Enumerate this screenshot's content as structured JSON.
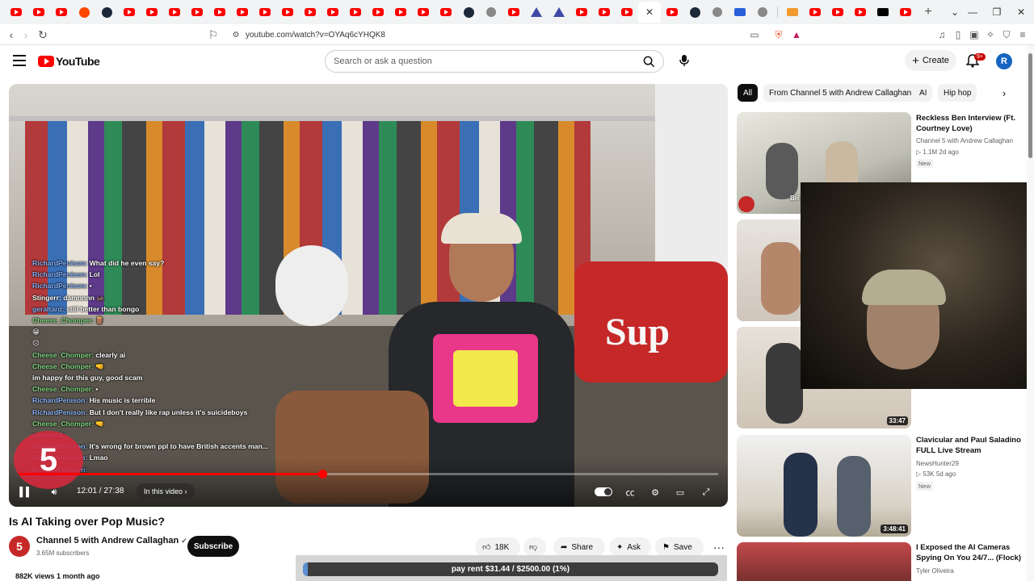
{
  "browser": {
    "url": "youtube.com/watch?v=OYAq6cYHQK8",
    "tab_icons": [
      "youtube",
      "youtube",
      "youtube",
      "reddit",
      "steam",
      "youtube",
      "youtube",
      "youtube",
      "youtube",
      "youtube",
      "youtube",
      "youtube",
      "youtube",
      "youtube",
      "youtube",
      "youtube",
      "youtube",
      "youtube",
      "youtube",
      "youtube",
      "steam",
      "gray",
      "youtube",
      "tri",
      "tri",
      "youtube",
      "youtube",
      "youtube",
      "active",
      "youtube",
      "steam",
      "gray",
      "blue",
      "gray"
    ],
    "tab_icons_right": [
      "orange",
      "youtube",
      "youtube",
      "youtube",
      "x",
      "youtube"
    ],
    "active_tab_close": "✕"
  },
  "youtube": {
    "logo_text": "YouTube",
    "search_placeholder": "Search or ask a question",
    "create_label": "Create",
    "notification_badge": "9+",
    "avatar_letter": "R"
  },
  "video": {
    "title": "Is AI Taking over Pop Music?",
    "channel": "Channel 5 with Andrew Callaghan",
    "subscribers": "3.65M subscribers",
    "subscribe_label": "Subscribe",
    "likes": "18K",
    "share_label": "Share",
    "ask_label": "Ask",
    "save_label": "Save",
    "views_date": "882K views  1 month ago",
    "time_current": "12:01",
    "time_total": "27:38",
    "progress_fraction": 0.434,
    "in_this_video": "In this video",
    "pillow_text": "Sup",
    "logo_mark": "5"
  },
  "chat": [
    {
      "user": "RichardPenison",
      "msg": "What did he even say?",
      "color": "blue"
    },
    {
      "user": "RichardPenison",
      "msg": "Lol",
      "color": "blue"
    },
    {
      "user": "RichardPenison",
      "msg": "▪",
      "color": "blue"
    },
    {
      "user": "Stingerr",
      "msg": "damnnnn 🦗",
      "color": "white"
    },
    {
      "user": "geraltard",
      "msg": "still better than bongo",
      "color": "blue"
    },
    {
      "user": "",
      "msg": "",
      "color": "green"
    },
    {
      "user": "Cheese_Chomper",
      "msg": "🪵",
      "color": "green"
    },
    {
      "user": "",
      "msg": "😁",
      "color": "green"
    },
    {
      "user": "",
      "msg": "☹",
      "color": "green"
    },
    {
      "user": "Cheese_Chomper",
      "msg": "clearly ai",
      "color": "green"
    },
    {
      "user": "Cheese_Chomper",
      "msg": "🤜",
      "color": "green"
    },
    {
      "user": "",
      "msg": "im happy for this guy, good scam",
      "color": "purple"
    },
    {
      "user": "Cheese_Chomper",
      "msg": "▪",
      "color": "green"
    },
    {
      "user": "RichardPenison",
      "msg": "His music is terrible",
      "color": "blue"
    },
    {
      "user": "RichardPenison",
      "msg": "But I don't really like rap unless it's suicideboys",
      "color": "blue"
    },
    {
      "user": "Cheese_Chomper",
      "msg": "🤜",
      "color": "green"
    },
    {
      "user": "geraltard",
      "msg": "",
      "color": "blue"
    },
    {
      "user": "RichardPenison",
      "msg": "It's wrong for brown ppl to have British accents man...",
      "color": "blue"
    },
    {
      "user": "RichardPenison",
      "msg": "Lmao",
      "color": "blue"
    },
    {
      "user": "RichardPenison",
      "msg": "",
      "color": "blue"
    }
  ],
  "chips": [
    "All",
    "From Channel 5 with Andrew Callaghan",
    "AI",
    "Hip hop"
  ],
  "recommendations": [
    {
      "title": "Reckless Ben Interview (Ft. Courtney Love)",
      "channel": "Channel 5 with Andrew Callaghan",
      "meta": "▷ 1.1M  2d ago",
      "badge": "New",
      "duration": "",
      "overlay_text": "Bri just"
    },
    {
      "title": "",
      "channel": "",
      "meta": "",
      "badge": "",
      "duration": ""
    },
    {
      "title": "",
      "channel": "",
      "meta": "",
      "badge": "",
      "duration": "33:47"
    },
    {
      "title": "Clavicular and Paul Saladino FULL Live Stream",
      "channel": "NewsHunter29",
      "meta": "▷ 53K  5d ago",
      "badge": "New",
      "duration": "3:48:41"
    },
    {
      "title": "I Exposed the AI Cameras Spying On You 24/7... (Flock)",
      "channel": "Tyler Oliveira",
      "meta": "",
      "badge": "",
      "duration": ""
    }
  ],
  "goal": {
    "text": "pay rent $31.44 / $2500.00 (1%)",
    "fraction": 0.0126
  },
  "colors": {
    "accent": "#ff0000",
    "goal_fill": "#5b8fd6",
    "subscribe_bg": "#0f0f0f"
  }
}
